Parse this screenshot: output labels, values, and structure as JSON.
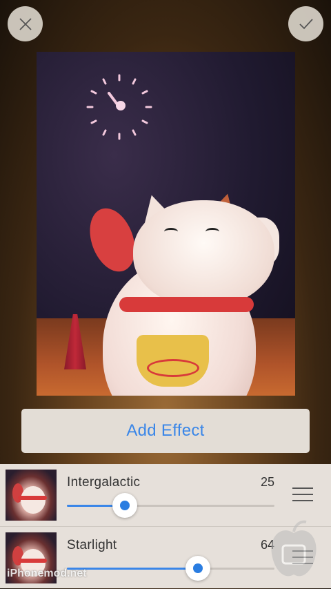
{
  "toolbar": {
    "close_icon": "close-icon",
    "confirm_icon": "checkmark-icon"
  },
  "add_effect_label": "Add Effect",
  "effects": [
    {
      "name": "Intergalactic",
      "value": "25",
      "level": 0.28
    },
    {
      "name": "Starlight",
      "value": "64",
      "level": 0.63
    }
  ],
  "watermark": "iPhonemod.net",
  "colors": {
    "accent": "#3a86e8",
    "panel": "#e6e0da",
    "button_bg": "#e3ddd6"
  }
}
